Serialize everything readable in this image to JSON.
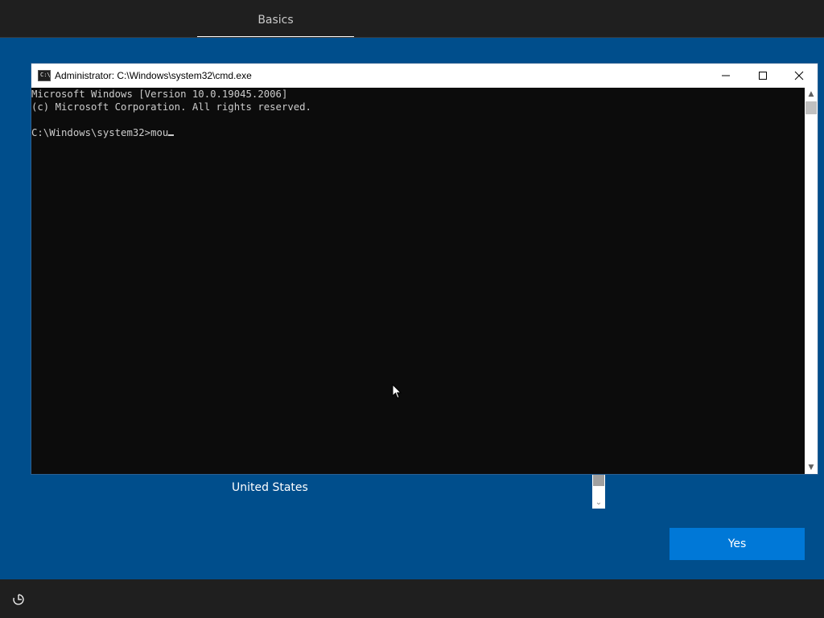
{
  "header": {
    "tab_label": "Basics"
  },
  "background": {
    "country_value": "United States",
    "yes_label": "Yes"
  },
  "cmd": {
    "title": "Administrator: C:\\Windows\\system32\\cmd.exe",
    "icon_text": "C:\\",
    "lines": [
      "Microsoft Windows [Version 10.0.19045.2006]",
      "(c) Microsoft Corporation. All rights reserved.",
      "",
      "C:\\Windows\\system32>mou"
    ]
  },
  "colors": {
    "oobe_background": "#004e8c",
    "accent_button": "#0078d7",
    "bar": "#1f1f1f",
    "console_background": "#0c0c0c",
    "console_text": "#cccccc"
  },
  "icons": {
    "accessibility": "ease-of-access-icon",
    "minimize": "minimize-icon",
    "maximize": "maximize-icon",
    "close": "close-icon",
    "pointer": "mouse-pointer-icon"
  }
}
